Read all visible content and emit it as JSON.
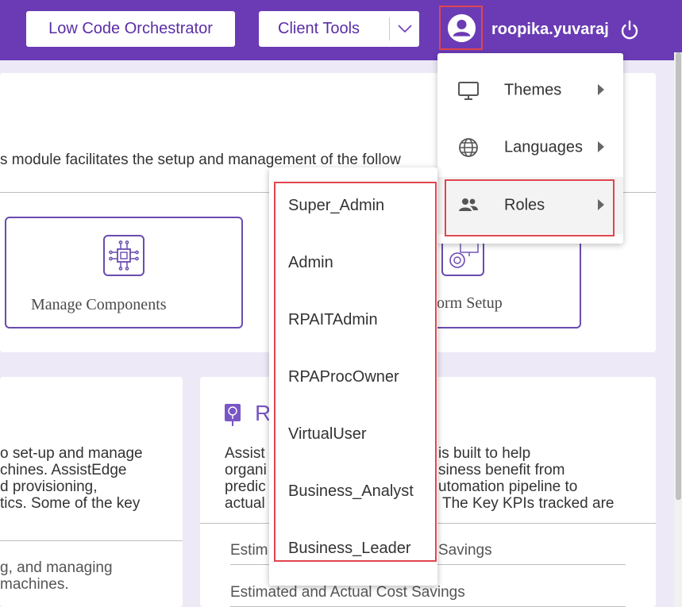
{
  "header": {
    "low_code_button": "Low Code Orchestrator",
    "client_tools_button": "Client Tools",
    "username": "roopika.yuvaraj"
  },
  "main": {
    "description": "s module facilitates the setup and management of the follow",
    "tiles": [
      "Manage Components",
      "orm Setup"
    ]
  },
  "left_card": {
    "lines": [
      "o set-up and manage",
      "chines. AssistEdge",
      "d provisioning,",
      "tics. Some of the key"
    ],
    "bottom_lines": [
      "g, and managing",
      "machines."
    ]
  },
  "right_card": {
    "title_letter": "R",
    "lines_left": [
      "Assist",
      "organi",
      "predic",
      "actual"
    ],
    "lines_right": [
      "is built to help",
      "siness benefit from",
      "utomation pipeline to",
      "The Key KPIs tracked are"
    ],
    "row1_left": "Estim",
    "row1_right": "Savings",
    "row2": "Estimated and Actual Cost Savings"
  },
  "user_menu": {
    "items": [
      {
        "label": "Themes",
        "icon": "monitor-icon"
      },
      {
        "label": "Languages",
        "icon": "globe-icon"
      },
      {
        "label": "Roles",
        "icon": "people-icon"
      }
    ]
  },
  "roles_submenu": {
    "items": [
      "Super_Admin",
      "Admin",
      "RPAITAdmin",
      "RPAProcOwner",
      "VirtualUser",
      "Business_Analyst",
      "Business_Leader"
    ]
  },
  "colors": {
    "brand": "#6a3bb5",
    "background": "#ede9f6",
    "highlight": "#e0454f"
  }
}
